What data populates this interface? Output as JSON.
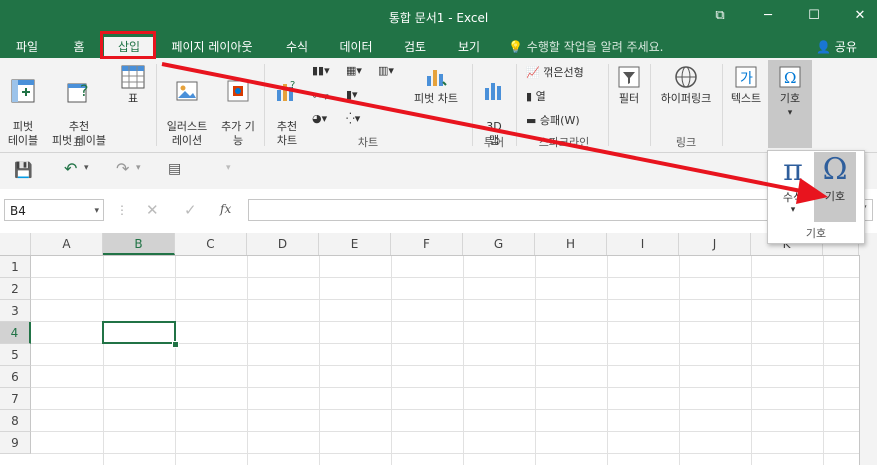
{
  "window": {
    "title": "통합 문서1 - Excel",
    "controls": [
      "⧉",
      "─",
      "☐",
      "✕"
    ]
  },
  "tabs": [
    {
      "label": "파일"
    },
    {
      "label": "홈"
    },
    {
      "label": "삽입",
      "active": true
    },
    {
      "label": "페이지 레이아웃"
    },
    {
      "label": "수식"
    },
    {
      "label": "데이터"
    },
    {
      "label": "검토"
    },
    {
      "label": "보기"
    }
  ],
  "tell_me": "수행할 작업을 알려 주세요.",
  "share": "공유",
  "ribbon": {
    "pivot_table": "피벗\n테이블",
    "recommended_pivot": "추천\n피벗 테이블",
    "table": "표",
    "tables_group": "표",
    "illustrations": "일러스트\n레이션",
    "addins": "추가 기\n능",
    "recommended_charts": "추천\n차트",
    "pivot_chart": "피벗 차트",
    "charts_group": "차트",
    "map3d": "3D\n맵",
    "tours_group": "투어",
    "sparkline_line": "꺾은선형",
    "sparkline_column": "열",
    "sparkline_winloss": "승패(W)",
    "sparklines_group": "스파크라인",
    "filter": "필터",
    "hyperlink": "하이퍼링크",
    "links_group": "링크",
    "text": "텍스트",
    "symbols": "기호"
  },
  "formula_bar": {
    "name_box": "B4",
    "fx": "fx"
  },
  "columns": [
    "A",
    "B",
    "C",
    "D",
    "E",
    "F",
    "G",
    "H",
    "I",
    "J",
    "K"
  ],
  "rows": [
    "1",
    "2",
    "3",
    "4",
    "5",
    "6",
    "7",
    "8",
    "9"
  ],
  "selected_cell": "B4",
  "popup": {
    "equation": "수식",
    "symbol": "기호",
    "group_label": "기호"
  },
  "colors": {
    "excel_green": "#217346",
    "highlight_red": "#e8141e"
  }
}
